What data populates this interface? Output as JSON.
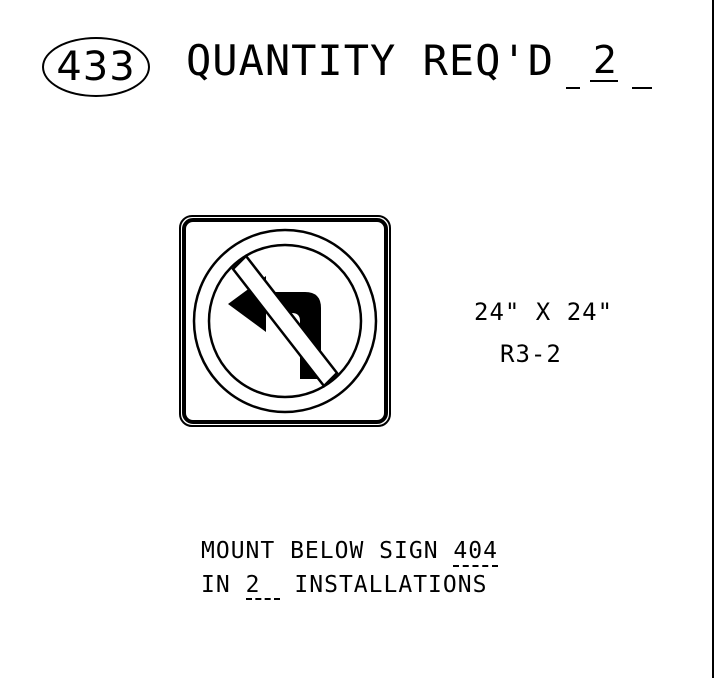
{
  "sign_number": "433",
  "quantity": {
    "label": "QUANTITY REQ'D",
    "value": "2"
  },
  "sign": {
    "size": "24\" X 24\"",
    "code": "R3-2",
    "icon": "no-left-turn-icon",
    "colors": {
      "legend": "#000000",
      "background": "#ffffff"
    }
  },
  "mounting": {
    "line1_prefix": "MOUNT BELOW SIGN",
    "below_sign": "404",
    "line2_prefix": "IN",
    "installations": "2",
    "line2_suffix": "INSTALLATIONS"
  }
}
